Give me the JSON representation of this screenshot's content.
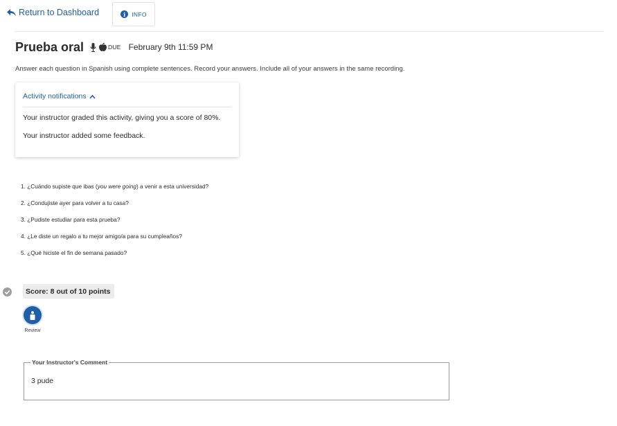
{
  "nav": {
    "back_label": "Return to Dashboard",
    "info_label": "INFO"
  },
  "assignment": {
    "title": "Prueba oral",
    "due_label": "DUE",
    "due_date": "February 9th 11:59 PM",
    "instructions": "Answer each question in Spanish using complete sentences. Record your answers. Include all of your answers in the same recording."
  },
  "notifications": {
    "header": "Activity notifications",
    "messages": [
      "Your instructor graded this activity, giving you a score of 80%.",
      "Your instructor added some feedback."
    ]
  },
  "questions": [
    {
      "before": "1. ¿Cuándo supiste que ibas (",
      "italic": "you were going",
      "after": ") a venir a esta universidad?"
    },
    {
      "before": "2. ¿Condujiste ayer para volver a tu casa?",
      "italic": "",
      "after": ""
    },
    {
      "before": "3. ¿Pudiste estudiar para esta prueba?",
      "italic": "",
      "after": ""
    },
    {
      "before": "4. ¿Le diste un regalo a tu mejor amigo/a para su cumpleaños?",
      "italic": "",
      "after": ""
    },
    {
      "before": "5. ¿Qué hiciste el fin de semana pasado?",
      "italic": "",
      "after": ""
    }
  ],
  "score": {
    "text": "Score: 8 out of 10 points"
  },
  "review": {
    "label": "Review"
  },
  "comment": {
    "legend": "Your Instructor's Comment",
    "text": "3 pude"
  },
  "colors": {
    "accent": "#1f5fa8",
    "score_bg": "#ececec"
  }
}
